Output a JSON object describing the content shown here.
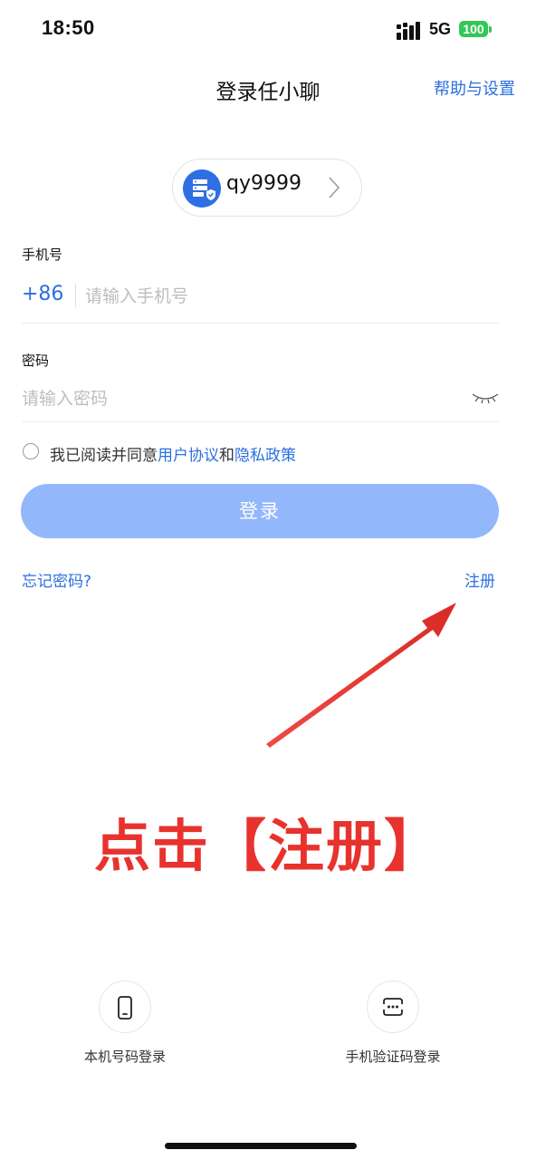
{
  "status_bar": {
    "time": "18:50",
    "network": "5G",
    "battery": "100"
  },
  "header": {
    "title": "登录任小聊",
    "help_label": "帮助与设置"
  },
  "server": {
    "name": "qy9999"
  },
  "phone": {
    "label": "手机号",
    "country_code": "+86",
    "placeholder": "请输入手机号",
    "value": ""
  },
  "password": {
    "label": "密码",
    "placeholder": "请输入密码",
    "value": ""
  },
  "agreement": {
    "prefix": "我已阅读并同意",
    "user_agreement": "用户协议",
    "conjunction": "和",
    "privacy_policy": "隐私政策",
    "checked": false
  },
  "login_button": "登录",
  "forgot_password": "忘记密码?",
  "register": "注册",
  "annotation": {
    "text": "点击【注册】",
    "color": "#e8322e"
  },
  "alt_login": {
    "local_number": "本机号码登录",
    "sms_code": "手机验证码登录"
  },
  "colors": {
    "accent": "#2b6fe0",
    "button_disabled": "#93b7fb",
    "battery": "#34c759"
  },
  "icons": {
    "server": "server-icon",
    "chevron": "chevron-right-icon",
    "eye": "eye-closed-icon",
    "phone": "mobile-phone-icon",
    "sms": "sms-code-icon"
  }
}
